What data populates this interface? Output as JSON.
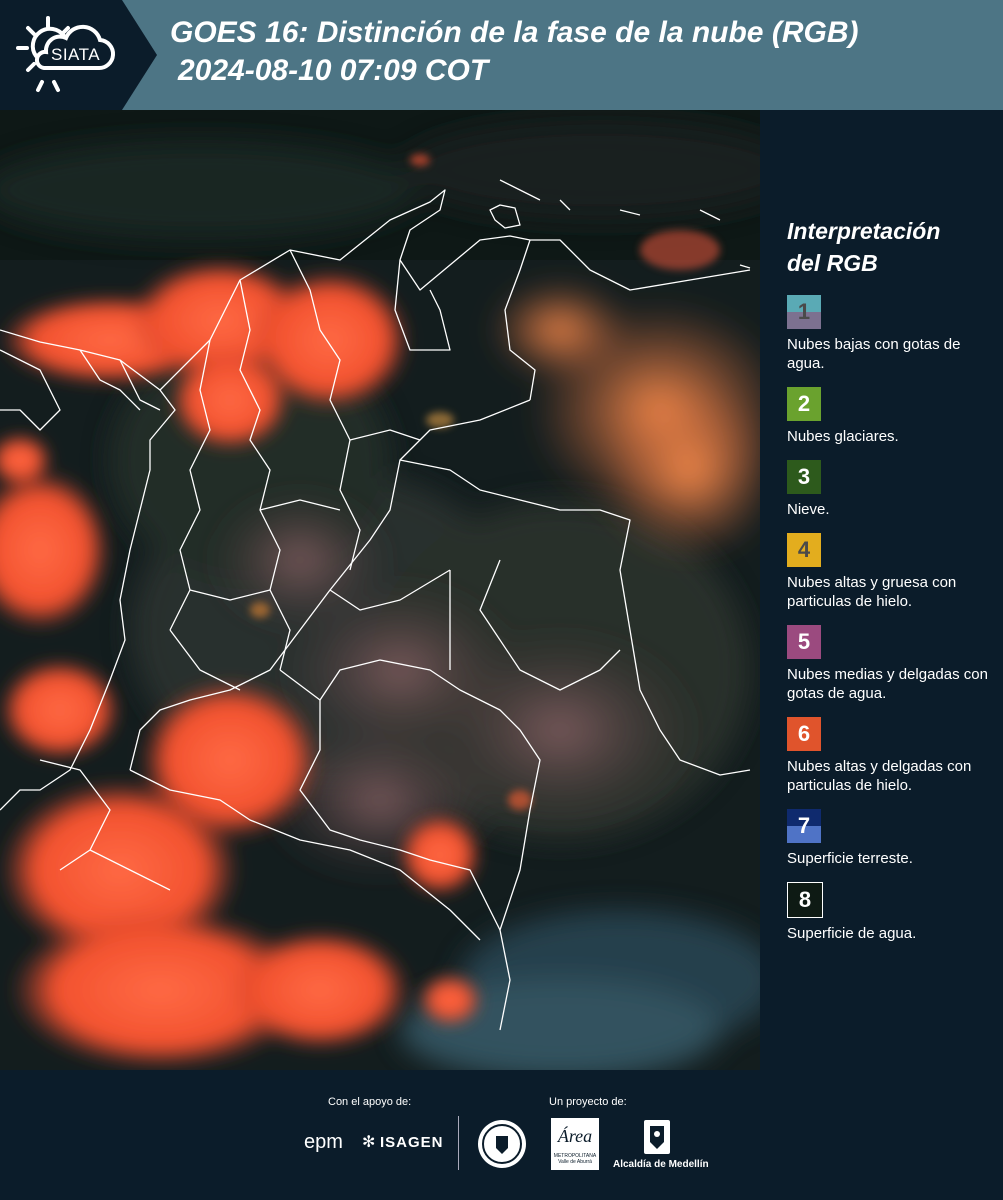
{
  "header": {
    "logo_text": "SIATA",
    "title_line1": "GOES 16: Distinción de la fase de la nube (RGB)",
    "title_line2": "2024-08-10 07:09 COT"
  },
  "legend": {
    "title_line1": "Interpretación",
    "title_line2": "del RGB",
    "items": [
      {
        "number": "1",
        "label": "Nubes bajas con gotas de agua.",
        "color_top": "#5aaab5",
        "color_bottom": "#7c7190",
        "number_color": "#4a4a4a"
      },
      {
        "number": "2",
        "label": "Nubes glaciares.",
        "color_top": "#6aa22e",
        "color_bottom": "#6aa22e",
        "number_color": "#ffffff"
      },
      {
        "number": "3",
        "label": "Nieve.",
        "color_top": "#2d5a1c",
        "color_bottom": "#2d5a1c",
        "number_color": "#ffffff"
      },
      {
        "number": "4",
        "label": "Nubes altas y gruesa con particulas de hielo.",
        "color_top": "#e3ad1e",
        "color_bottom": "#e3ad1e",
        "number_color": "#4a4a4a"
      },
      {
        "number": "5",
        "label": "Nubes medias y delgadas con gotas de agua.",
        "color_top": "#9b4a7f",
        "color_bottom": "#9b4a7f",
        "number_color": "#ffffff"
      },
      {
        "number": "6",
        "label": "Nubes altas y delgadas con particulas de hielo.",
        "color_top": "#e0542c",
        "color_bottom": "#e0542c",
        "number_color": "#ffffff"
      },
      {
        "number": "7",
        "label": "Superficie terreste.",
        "color_top": "#0f2a6e",
        "color_bottom": "#4f73c6",
        "number_color": "#ffffff"
      },
      {
        "number": "8",
        "label": "Superficie de agua.",
        "color_top": "#0e1a14",
        "color_bottom": "#0e1a14",
        "number_color": "#ffffff"
      }
    ]
  },
  "footer": {
    "support_label": "Con el apoyo de:",
    "project_label": "Un proyecto de:",
    "sponsor_epm": "epm",
    "sponsor_isagen": "ISAGEN",
    "area_main": "Área",
    "area_sub1": "METROPOLITANA",
    "area_sub2": "Valle de Aburrá",
    "alcaldia": "Alcaldía de Medellín"
  },
  "colors": {
    "header_bg": "#4d7585",
    "dark_bg": "#0b1c2a",
    "cloud_orange": "#ff5a36"
  }
}
